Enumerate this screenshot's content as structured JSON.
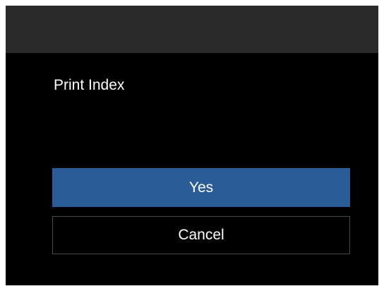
{
  "dialog": {
    "title": "Print Index",
    "yes_label": "Yes",
    "cancel_label": "Cancel"
  },
  "colors": {
    "background": "#000000",
    "title_bar": "#2b2b2b",
    "selected_button": "#2a5d97",
    "button_border": "#4a4a4a",
    "text": "#ffffff"
  }
}
